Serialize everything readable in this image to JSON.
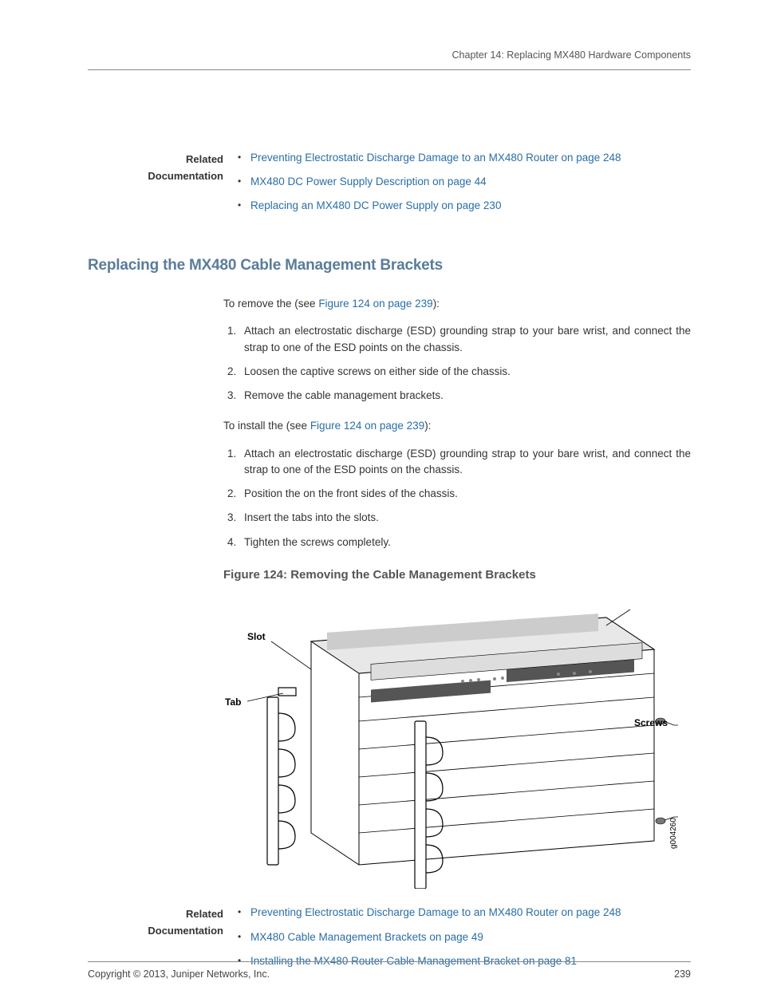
{
  "header": {
    "chapter": "Chapter 14: Replacing MX480 Hardware Components"
  },
  "related_top": {
    "label_line1": "Related",
    "label_line2": "Documentation",
    "items": [
      "Preventing Electrostatic Discharge Damage to an MX480 Router on page 248",
      "MX480 DC Power Supply Description on page 44",
      "Replacing an MX480 DC Power Supply on page 230"
    ]
  },
  "section": {
    "title": "Replacing the MX480 Cable Management Brackets",
    "remove_intro_pre": "To remove the (see ",
    "remove_intro_link": "Figure 124 on page 239",
    "remove_intro_post": "):",
    "remove_steps": [
      "Attach an electrostatic discharge (ESD) grounding strap to your bare wrist, and connect the strap to one of the ESD points on the chassis.",
      "Loosen the captive screws on either side of the chassis.",
      "Remove the cable management brackets."
    ],
    "install_intro_pre": "To install the (see ",
    "install_intro_link": "Figure 124 on page 239",
    "install_intro_post": "):",
    "install_steps": [
      "Attach an electrostatic discharge (ESD) grounding strap to your bare wrist, and connect the strap to one of the ESD points on the chassis.",
      "Position the on the front sides of the chassis.",
      "Insert the tabs into the slots.",
      "Tighten the screws completely."
    ]
  },
  "figure": {
    "caption": "Figure 124: Removing the Cable Management Brackets",
    "labels": {
      "slot": "Slot",
      "tab": "Tab",
      "screws": "Screws"
    },
    "id": "g004260"
  },
  "related_bottom": {
    "label_line1": "Related",
    "label_line2": "Documentation",
    "items": [
      "Preventing Electrostatic Discharge Damage to an MX480 Router on page 248",
      "MX480 Cable Management Brackets on page 49",
      "Installing the MX480 Router Cable Management Bracket on page 81"
    ]
  },
  "footer": {
    "copyright": "Copyright © 2013, Juniper Networks, Inc.",
    "page": "239"
  }
}
